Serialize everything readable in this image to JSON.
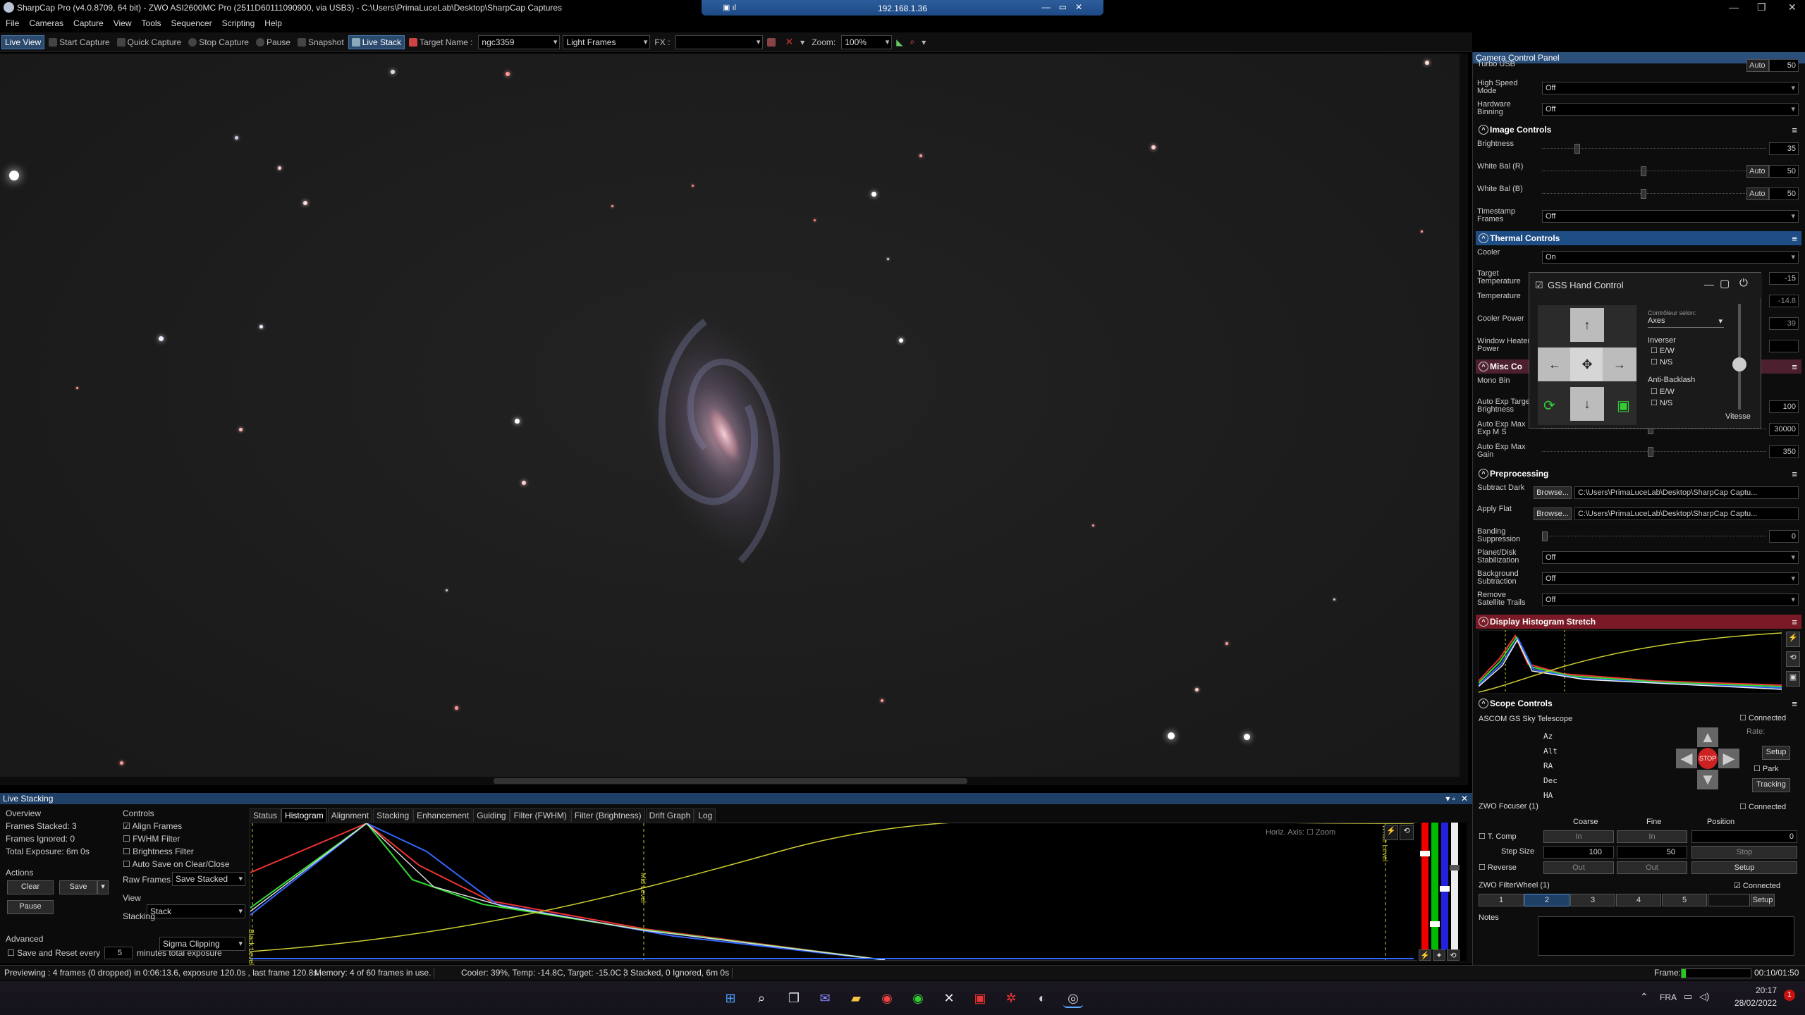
{
  "window": {
    "title": "SharpCap Pro (v4.0.8709, 64 bit) - ZWO ASI2600MC Pro (2511D60111090900, via USB3) - C:\\Users\\PrimaLuceLab\\Desktop\\SharpCap Captures",
    "remote_ip": "192.168.1.36"
  },
  "menu": [
    "File",
    "Cameras",
    "Capture",
    "View",
    "Tools",
    "Sequencer",
    "Scripting",
    "Help"
  ],
  "toolbar": {
    "live_view": "Live View",
    "start_capture": "Start Capture",
    "quick_capture": "Quick Capture",
    "stop_capture": "Stop Capture",
    "pause": "Pause",
    "snapshot": "Snapshot",
    "live_stack": "Live Stack",
    "target_name_label": "Target Name :",
    "target_name_value": "ngc3359",
    "frame_type": "Light Frames",
    "fx_label": "FX :",
    "fx_value": "",
    "zoom_label": "Zoom:",
    "zoom_value": "100%"
  },
  "panel": {
    "title": "Camera Control Panel",
    "turbo_usb": {
      "label": "Turbo USB",
      "value": "Auto",
      "num": "50"
    },
    "high_speed": {
      "label": "High Speed Mode",
      "value": "Off"
    },
    "hardware_binning": {
      "label": "Hardware Binning",
      "value": "Off"
    },
    "image_controls": {
      "title": "Image Controls",
      "brightness": {
        "label": "Brightness",
        "value": "35"
      },
      "wb_r": {
        "label": "White Bal (R)",
        "auto": "Auto",
        "value": "50"
      },
      "wb_b": {
        "label": "White Bal (B)",
        "auto": "Auto",
        "value": "50"
      },
      "timestamp": {
        "label": "Timestamp Frames",
        "value": "Off"
      }
    },
    "thermal": {
      "title": "Thermal Controls",
      "cooler": {
        "label": "Cooler",
        "value": "On"
      },
      "target_temp": {
        "label": "Target Temperature",
        "value": "-15"
      },
      "temperature": {
        "label": "Temperature",
        "value": "-14.8"
      },
      "cooler_power": {
        "label": "Cooler Power",
        "value": "39"
      },
      "window_heater": {
        "label": "Window Heater Power",
        "value": ""
      }
    },
    "misc": {
      "title": "Misc Co",
      "mono_bin": {
        "label": "Mono Bin"
      },
      "auto_exp_target": {
        "label": "Auto Exp Target Brightness",
        "value": "100"
      },
      "auto_exp_max_ms": {
        "label": "Auto Exp Max Exp M S",
        "value": "30000"
      },
      "auto_exp_max_gain": {
        "label": "Auto Exp Max Gain",
        "value": "350"
      }
    },
    "preprocessing": {
      "title": "Preprocessing",
      "subtract_dark": {
        "label": "Subtract Dark",
        "button": "Browse...",
        "path": "C:\\Users\\PrimaLuceLab\\Desktop\\SharpCap Captu..."
      },
      "apply_flat": {
        "label": "Apply Flat",
        "button": "Browse...",
        "path": "C:\\Users\\PrimaLuceLab\\Desktop\\SharpCap Captu..."
      },
      "banding": {
        "label": "Banding Suppression",
        "value": "0"
      },
      "planet_disk": {
        "label": "Planet/Disk Stabilization",
        "value": "Off"
      },
      "background": {
        "label": "Background Subtraction",
        "value": "Off"
      },
      "satellite": {
        "label": "Remove Satellite Trails",
        "value": "Off"
      }
    },
    "histogram": {
      "title": "Display Histogram Stretch"
    },
    "scope": {
      "title": "Scope Controls",
      "connected": "Connected",
      "telescope": "ASCOM GS Sky Telescope",
      "az": "Az",
      "alt": "Alt",
      "ra": "RA",
      "dec": "Dec",
      "ha": "HA",
      "rate": "Rate:",
      "setup": "Setup",
      "park": "Park",
      "tracking": "Tracking",
      "stop": "STOP"
    },
    "focuser": {
      "title": "ZWO Focuser (1)",
      "connected": "Connected",
      "coarse": "Coarse",
      "fine": "Fine",
      "position": "Position",
      "tcomp": "T. Comp",
      "in": "In",
      "pos_value": "0",
      "step_size": "Step Size",
      "coarse_step": "100",
      "fine_step": "50",
      "stop": "Stop",
      "reverse": "Reverse",
      "out": "Out",
      "setup": "Setup"
    },
    "filterwheel": {
      "title": "ZWO FilterWheel (1)",
      "connected": "Connected",
      "slots": [
        "1",
        "2",
        "3",
        "4",
        "5"
      ],
      "setup": "Setup"
    },
    "notes": {
      "label": "Notes"
    }
  },
  "hand_control": {
    "title": "GSS Hand Control",
    "controller_label": "Contrôleur selon:",
    "controller_value": "Axes",
    "inverse": "Inverser",
    "ew": "E/W",
    "ns": "N/S",
    "anti_backlash": "Anti-Backlash",
    "speed": "Vitesse"
  },
  "live_stacking": {
    "title": "Live Stacking",
    "overview": "Overview",
    "frames_stacked": "Frames Stacked: 3",
    "frames_ignored": "Frames Ignored: 0",
    "total_exposure": "Total Exposure:   6m 0s",
    "actions": "Actions",
    "clear": "Clear",
    "save": "Save",
    "pause": "Pause",
    "advanced": "Advanced",
    "save_reset": "Save and Reset every",
    "save_reset_value": "5",
    "minutes_label": "minutes total exposure",
    "controls": "Controls",
    "align": "Align Frames",
    "fwhm": "FWHM Filter",
    "brightness": "Brightness Filter",
    "auto_save": "Auto Save on Clear/Close",
    "raw_frames_label": "Raw Frames",
    "raw_frames_value": "Save Stacked",
    "view_label": "View",
    "view_value": "Stack",
    "stacking_label": "Stacking",
    "stacking_value": "Sigma Clipping",
    "tabs": [
      "Status",
      "Histogram",
      "Alignment",
      "Stacking",
      "Enhancement",
      "Guiding",
      "Filter (FWHM)",
      "Filter (Brightness)",
      "Drift Graph",
      "Log"
    ],
    "horiz_axis": "Horiz. Axis:",
    "zoom": "Zoom",
    "black_level": "Black Level",
    "mid_level": "Mid Level",
    "white_level": "White Level"
  },
  "status": {
    "preview": "Previewing : 4 frames (0 dropped) in 0:06:13.6, exposure 120.0s , last frame 120.8s",
    "memory": "Memory: 4 of 60 frames in use.",
    "cooler": "Cooler: 39%, Temp: -14.8C, Target: -15.0C",
    "stacked": "3 Stacked, 0 Ignored, 6m 0s",
    "frame_label": "Frame:",
    "timer": "00:10/01:50"
  },
  "taskbar": {
    "lang": "FRA",
    "time": "20:17",
    "date": "28/02/2022"
  }
}
